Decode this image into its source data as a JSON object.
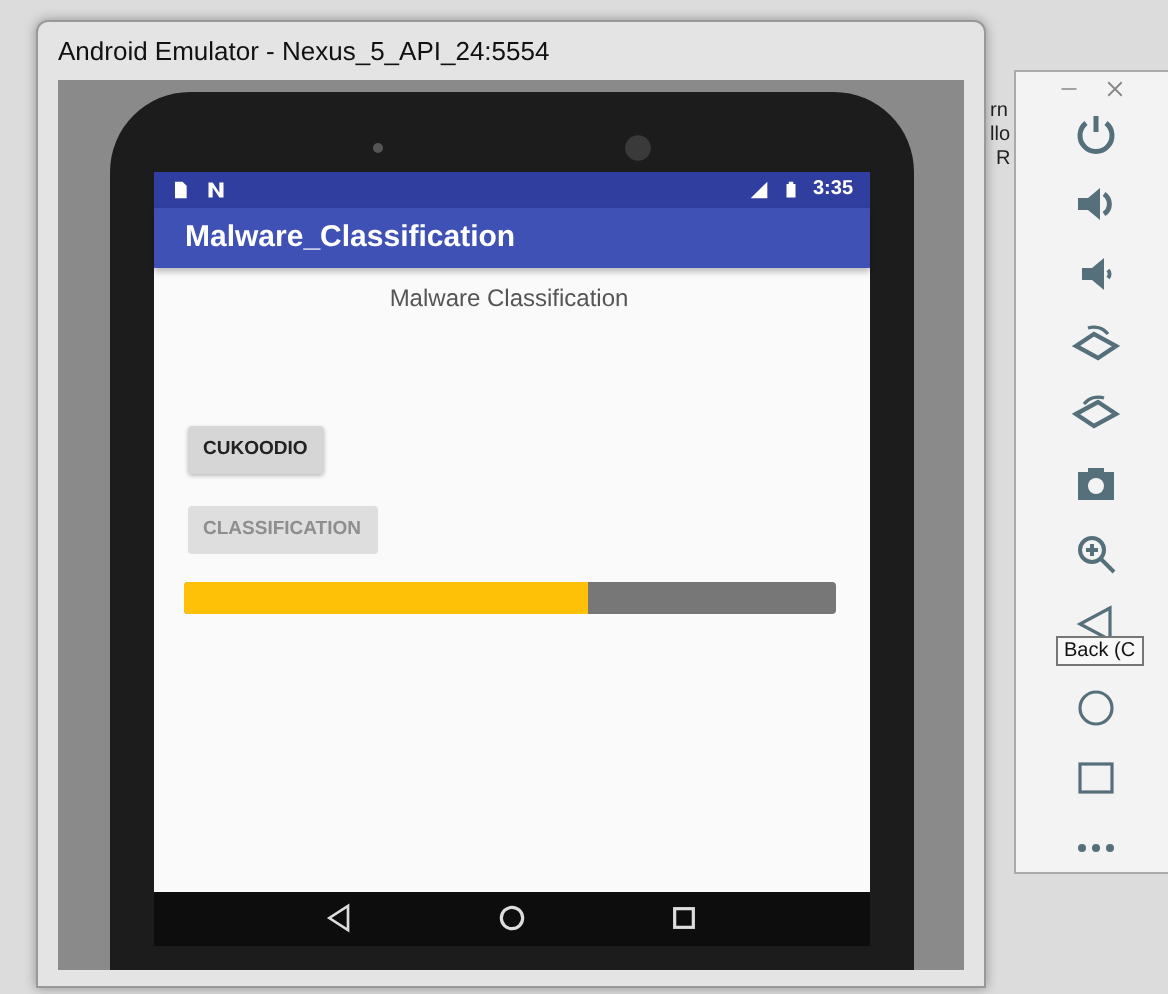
{
  "window": {
    "title": "Android Emulator - Nexus_5_API_24:5554"
  },
  "status_bar": {
    "time": "3:35"
  },
  "app_bar": {
    "title": "Malware_Classification"
  },
  "content": {
    "heading": "Malware Classification",
    "buttons": [
      {
        "label": "CUKOODIO",
        "disabled": false
      },
      {
        "label": "CLASSIFICATION",
        "disabled": true
      }
    ],
    "progress": {
      "level": 0.62
    }
  },
  "toolbar": {
    "tooltip": "Back (C"
  },
  "background_text": [
    "rn",
    "llo",
    "R"
  ]
}
